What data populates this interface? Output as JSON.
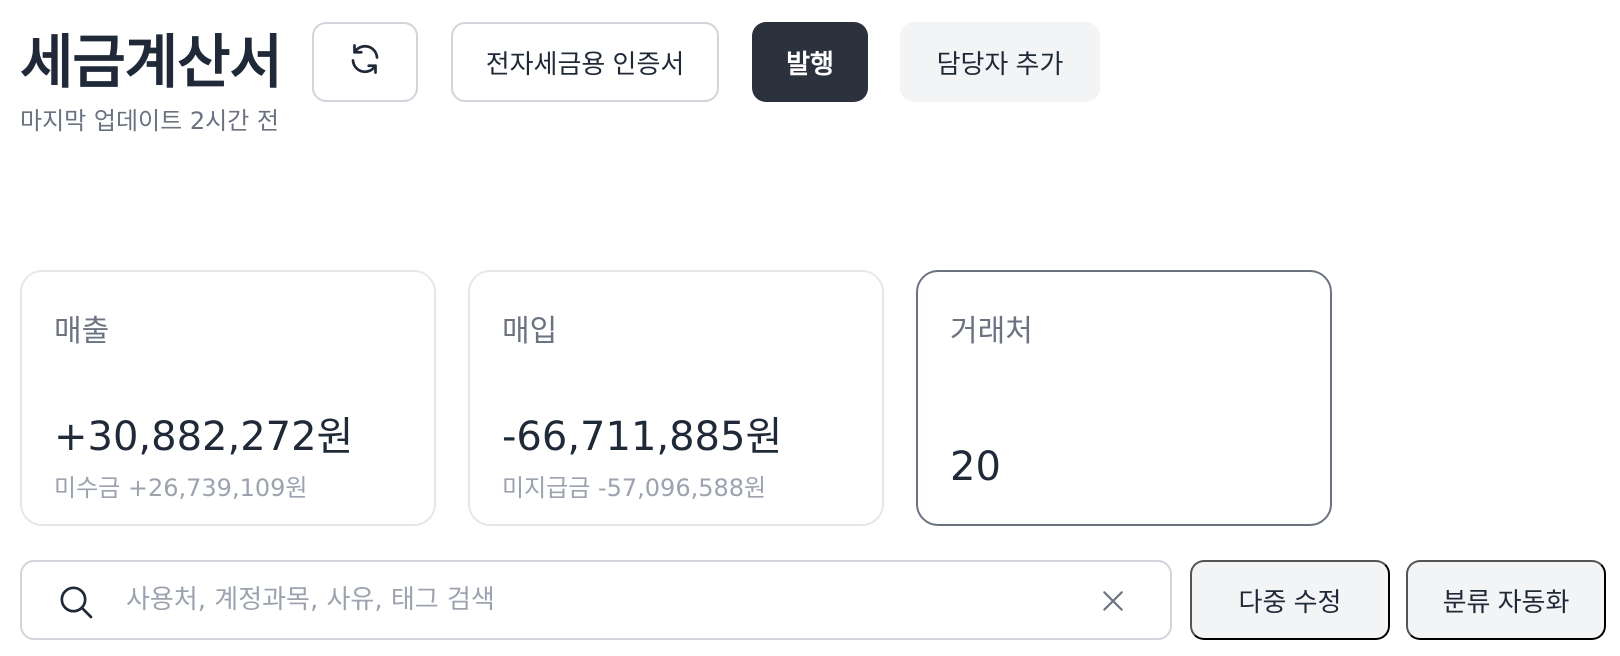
{
  "header": {
    "title": "세금계산서",
    "subtitle": "마지막 업데이트 2시간 전"
  },
  "toolbar": {
    "refresh_icon": "refresh-icon",
    "cert_label": "전자세금용 인증서",
    "issue_label": "발행",
    "add_manager_label": "담당자 추가"
  },
  "cards": {
    "sales": {
      "label": "매출",
      "value": "+30,882,272원",
      "sub": "미수금 +26,739,109원"
    },
    "purchase": {
      "label": "매입",
      "value": "-66,711,885원",
      "sub": "미지급금 -57,096,588원"
    },
    "partners": {
      "label": "거래처",
      "value": "20"
    }
  },
  "search": {
    "placeholder": "사용처, 계정과목, 사유, 태그 검색",
    "value": "",
    "icon": "search-icon",
    "clear_icon": "close-icon"
  },
  "actions": {
    "multi_edit_label": "다중 수정",
    "auto_classify_label": "분류 자동화"
  },
  "colors": {
    "primary_dark": "#2b313d",
    "text": "#1f2937",
    "muted": "#6b7280",
    "soft_bg": "#f3f4f6"
  }
}
